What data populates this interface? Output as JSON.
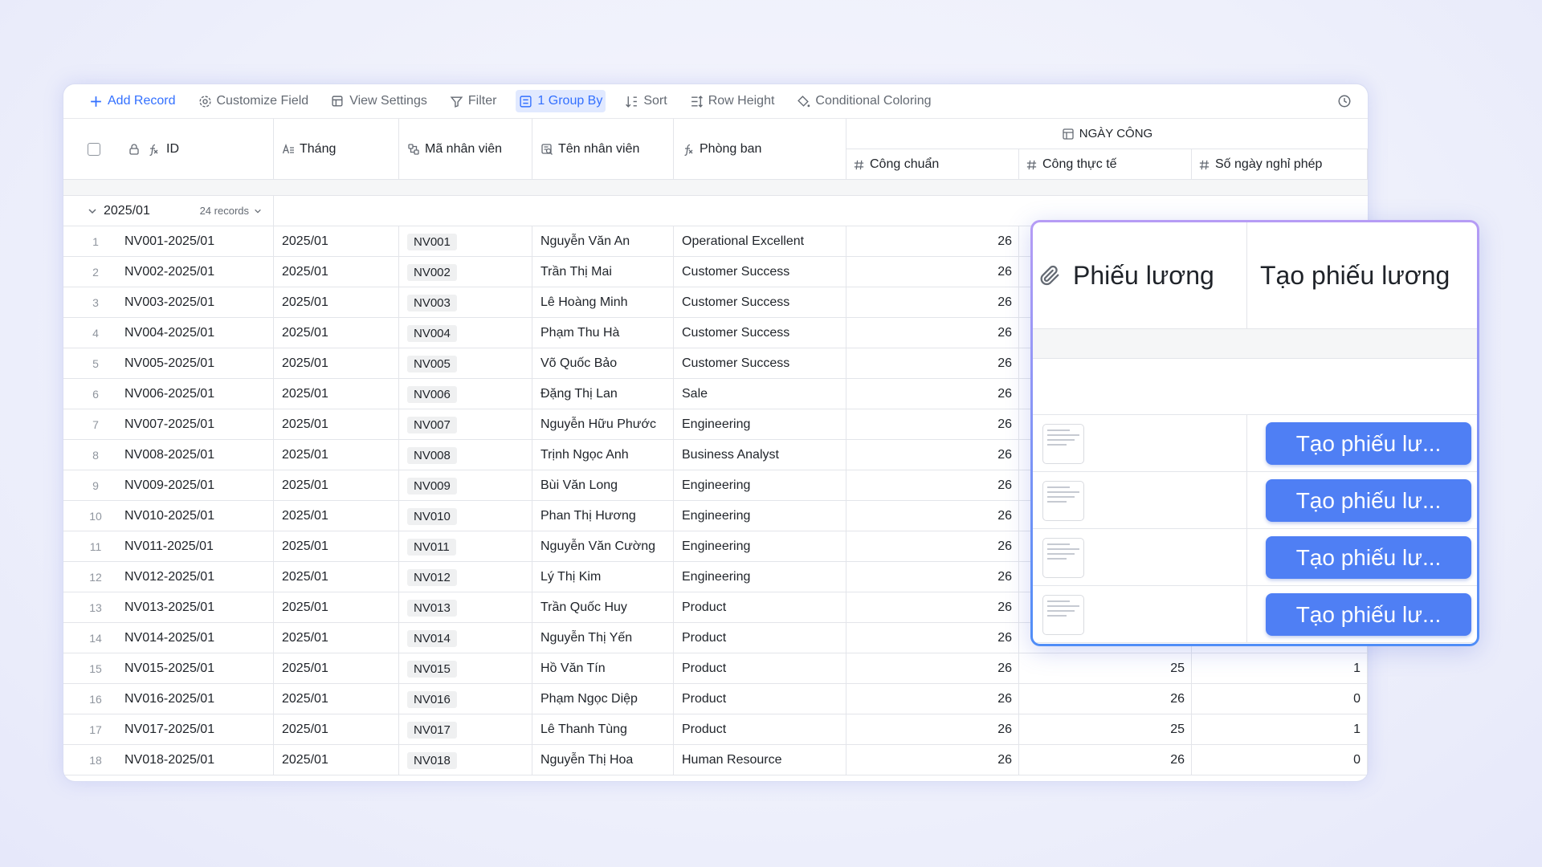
{
  "toolbar": {
    "add_record": "Add Record",
    "customize_field": "Customize Field",
    "view_settings": "View Settings",
    "filter": "Filter",
    "group_by": "1 Group By",
    "sort": "Sort",
    "row_height": "Row Height",
    "conditional_coloring": "Conditional Coloring"
  },
  "columns": {
    "id": "ID",
    "thang": "Tháng",
    "ma_nv": "Mã nhân viên",
    "ten_nv": "Tên nhân viên",
    "phong_ban": "Phòng ban",
    "group_title": "NGÀY CÔNG",
    "cong_chuan": "Công chuẩn",
    "cong_thuc_te": "Công thực tế",
    "so_ngay_nghi": "Số ngày nghỉ phép"
  },
  "group": {
    "label": "2025/01",
    "count": "24 records"
  },
  "rows": [
    {
      "n": "1",
      "id": "NV001-2025/01",
      "thang": "2025/01",
      "ma": "NV001",
      "ten": "Nguyễn Văn An",
      "pb": "Operational Excellent",
      "cc": "26",
      "ctt": "",
      "nghi": ""
    },
    {
      "n": "2",
      "id": "NV002-2025/01",
      "thang": "2025/01",
      "ma": "NV002",
      "ten": "Trần Thị Mai",
      "pb": "Customer Success",
      "cc": "26",
      "ctt": "",
      "nghi": ""
    },
    {
      "n": "3",
      "id": "NV003-2025/01",
      "thang": "2025/01",
      "ma": "NV003",
      "ten": "Lê Hoàng Minh",
      "pb": "Customer Success",
      "cc": "26",
      "ctt": "",
      "nghi": ""
    },
    {
      "n": "4",
      "id": "NV004-2025/01",
      "thang": "2025/01",
      "ma": "NV004",
      "ten": "Phạm Thu Hà",
      "pb": "Customer Success",
      "cc": "26",
      "ctt": "",
      "nghi": ""
    },
    {
      "n": "5",
      "id": "NV005-2025/01",
      "thang": "2025/01",
      "ma": "NV005",
      "ten": "Võ Quốc Bảo",
      "pb": "Customer Success",
      "cc": "26",
      "ctt": "",
      "nghi": ""
    },
    {
      "n": "6",
      "id": "NV006-2025/01",
      "thang": "2025/01",
      "ma": "NV006",
      "ten": "Đặng Thị Lan",
      "pb": "Sale",
      "cc": "26",
      "ctt": "",
      "nghi": ""
    },
    {
      "n": "7",
      "id": "NV007-2025/01",
      "thang": "2025/01",
      "ma": "NV007",
      "ten": "Nguyễn Hữu Phước",
      "pb": "Engineering",
      "cc": "26",
      "ctt": "",
      "nghi": ""
    },
    {
      "n": "8",
      "id": "NV008-2025/01",
      "thang": "2025/01",
      "ma": "NV008",
      "ten": "Trịnh Ngọc Anh",
      "pb": "Business Analyst",
      "cc": "26",
      "ctt": "",
      "nghi": ""
    },
    {
      "n": "9",
      "id": "NV009-2025/01",
      "thang": "2025/01",
      "ma": "NV009",
      "ten": "Bùi Văn Long",
      "pb": "Engineering",
      "cc": "26",
      "ctt": "",
      "nghi": ""
    },
    {
      "n": "10",
      "id": "NV010-2025/01",
      "thang": "2025/01",
      "ma": "NV010",
      "ten": "Phan Thị Hương",
      "pb": "Engineering",
      "cc": "26",
      "ctt": "",
      "nghi": ""
    },
    {
      "n": "11",
      "id": "NV011-2025/01",
      "thang": "2025/01",
      "ma": "NV011",
      "ten": "Nguyễn Văn Cường",
      "pb": "Engineering",
      "cc": "26",
      "ctt": "",
      "nghi": ""
    },
    {
      "n": "12",
      "id": "NV012-2025/01",
      "thang": "2025/01",
      "ma": "NV012",
      "ten": "Lý Thị Kim",
      "pb": "Engineering",
      "cc": "26",
      "ctt": "",
      "nghi": ""
    },
    {
      "n": "13",
      "id": "NV013-2025/01",
      "thang": "2025/01",
      "ma": "NV013",
      "ten": "Trần Quốc Huy",
      "pb": "Product",
      "cc": "26",
      "ctt": "",
      "nghi": ""
    },
    {
      "n": "14",
      "id": "NV014-2025/01",
      "thang": "2025/01",
      "ma": "NV014",
      "ten": "Nguyễn Thị Yến",
      "pb": "Product",
      "cc": "26",
      "ctt": "",
      "nghi": ""
    },
    {
      "n": "15",
      "id": "NV015-2025/01",
      "thang": "2025/01",
      "ma": "NV015",
      "ten": "Hồ Văn Tín",
      "pb": "Product",
      "cc": "26",
      "ctt": "25",
      "nghi": "1"
    },
    {
      "n": "16",
      "id": "NV016-2025/01",
      "thang": "2025/01",
      "ma": "NV016",
      "ten": "Phạm Ngọc Diệp",
      "pb": "Product",
      "cc": "26",
      "ctt": "26",
      "nghi": "0"
    },
    {
      "n": "17",
      "id": "NV017-2025/01",
      "thang": "2025/01",
      "ma": "NV017",
      "ten": "Lê Thanh Tùng",
      "pb": "Product",
      "cc": "26",
      "ctt": "25",
      "nghi": "1"
    },
    {
      "n": "18",
      "id": "NV018-2025/01",
      "thang": "2025/01",
      "ma": "NV018",
      "ten": "Nguyễn Thị Hoa",
      "pb": "Human Resource",
      "cc": "26",
      "ctt": "26",
      "nghi": "0"
    }
  ],
  "popup": {
    "col_phieu": "Phiếu lương",
    "col_tao": "Tạo phiếu lương",
    "button_label": "Tạo phiếu lư..."
  }
}
